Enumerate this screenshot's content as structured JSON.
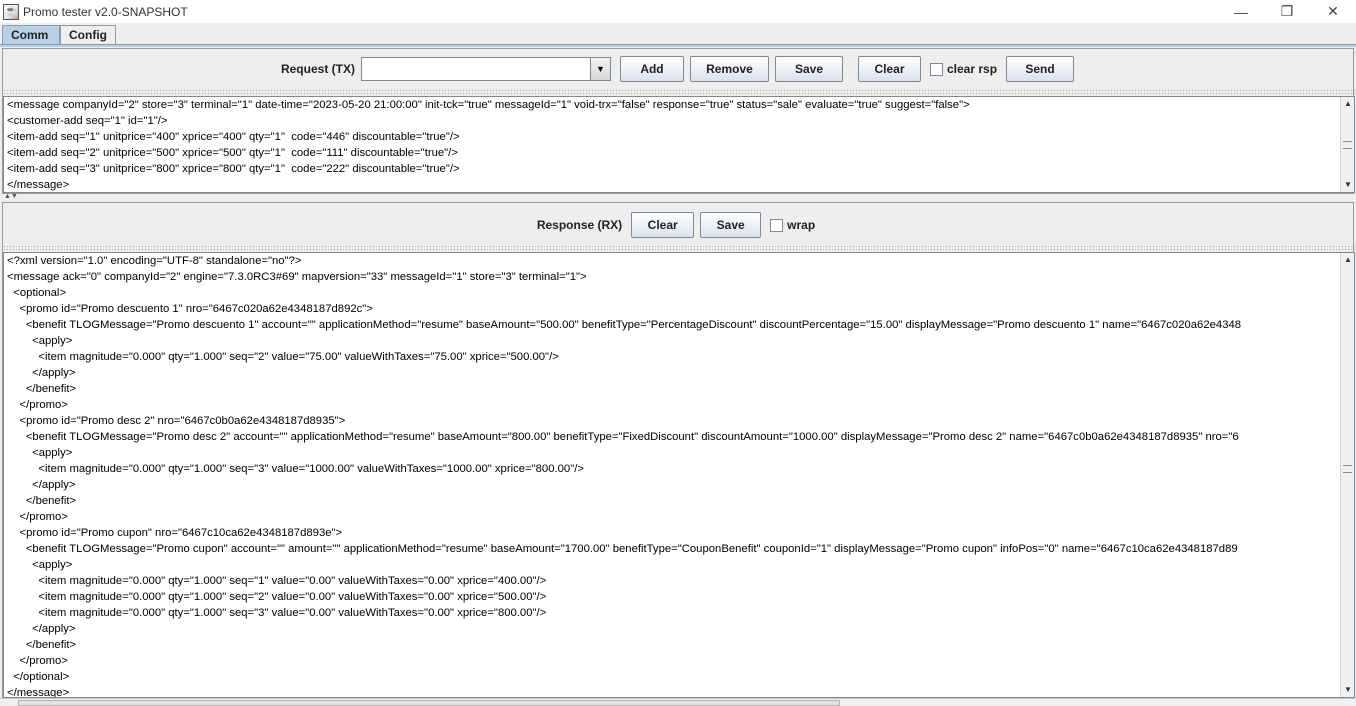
{
  "window": {
    "title": "Promo tester v2.0-SNAPSHOT",
    "icon": "java-cup-icon",
    "minimize_label": "—",
    "maximize_label": "❐",
    "close_label": "✕"
  },
  "tabs": [
    {
      "label": "Comm",
      "active": true
    },
    {
      "label": "Config",
      "active": false
    }
  ],
  "request": {
    "label": "Request (TX)",
    "combo_value": "",
    "buttons": {
      "add": "Add",
      "remove": "Remove",
      "save": "Save",
      "clear": "Clear",
      "send": "Send"
    },
    "clear_rsp_label": "clear rsp",
    "clear_rsp_checked": false,
    "lines": [
      "<message companyId=\"2\" store=\"3\" terminal=\"1\" date-time=\"2023-05-20 21:00:00\" init-tck=\"true\" messageId=\"1\" void-trx=\"false\" response=\"true\" status=\"sale\" evaluate=\"true\" suggest=\"false\">",
      "<customer-add seq=\"1\" id=\"1\"/>",
      "<item-add seq=\"1\" unitprice=\"400\" xprice=\"400\" qty=\"1\"  code=\"446\" discountable=\"true\"/>",
      "<item-add seq=\"2\" unitprice=\"500\" xprice=\"500\" qty=\"1\"  code=\"111\" discountable=\"true\"/>",
      "<item-add seq=\"3\" unitprice=\"800\" xprice=\"800\" qty=\"1\"  code=\"222\" discountable=\"true\"/>",
      "</message>"
    ]
  },
  "response": {
    "label": "Response (RX)",
    "buttons": {
      "clear": "Clear",
      "save": "Save"
    },
    "wrap_label": "wrap",
    "wrap_checked": false,
    "lines": [
      "<?xml version=\"1.0\" encoding=\"UTF-8\" standalone=\"no\"?>",
      "<message ack=\"0\" companyId=\"2\" engine=\"7.3.0RC3#69\" mapversion=\"33\" messageId=\"1\" store=\"3\" terminal=\"1\">",
      "  <optional>",
      "    <promo id=\"Promo descuento 1\" nro=\"6467c020a62e4348187d892c\">",
      "      <benefit TLOGMessage=\"Promo descuento 1\" account=\"\" applicationMethod=\"resume\" baseAmount=\"500.00\" benefitType=\"PercentageDiscount\" discountPercentage=\"15.00\" displayMessage=\"Promo descuento 1\" name=\"6467c020a62e4348",
      "        <apply>",
      "          <item magnitude=\"0.000\" qty=\"1.000\" seq=\"2\" value=\"75.00\" valueWithTaxes=\"75.00\" xprice=\"500.00\"/>",
      "        </apply>",
      "      </benefit>",
      "    </promo>",
      "    <promo id=\"Promo desc 2\" nro=\"6467c0b0a62e4348187d8935\">",
      "      <benefit TLOGMessage=\"Promo desc 2\" account=\"\" applicationMethod=\"resume\" baseAmount=\"800.00\" benefitType=\"FixedDiscount\" discountAmount=\"1000.00\" displayMessage=\"Promo desc 2\" name=\"6467c0b0a62e4348187d8935\" nro=\"6",
      "        <apply>",
      "          <item magnitude=\"0.000\" qty=\"1.000\" seq=\"3\" value=\"1000.00\" valueWithTaxes=\"1000.00\" xprice=\"800.00\"/>",
      "        </apply>",
      "      </benefit>",
      "    </promo>",
      "    <promo id=\"Promo cupon\" nro=\"6467c10ca62e4348187d893e\">",
      "      <benefit TLOGMessage=\"Promo cupon\" account=\"\" amount=\"\" applicationMethod=\"resume\" baseAmount=\"1700.00\" benefitType=\"CouponBenefit\" couponId=\"1\" displayMessage=\"Promo cupon\" infoPos=\"0\" name=\"6467c10ca62e4348187d89",
      "        <apply>",
      "          <item magnitude=\"0.000\" qty=\"1.000\" seq=\"1\" value=\"0.00\" valueWithTaxes=\"0.00\" xprice=\"400.00\"/>",
      "          <item magnitude=\"0.000\" qty=\"1.000\" seq=\"2\" value=\"0.00\" valueWithTaxes=\"0.00\" xprice=\"500.00\"/>",
      "          <item magnitude=\"0.000\" qty=\"1.000\" seq=\"3\" value=\"0.00\" valueWithTaxes=\"0.00\" xprice=\"800.00\"/>",
      "        </apply>",
      "      </benefit>",
      "    </promo>",
      "  </optional>",
      "</message>"
    ]
  },
  "colors": {
    "tab_active": "#b8cfe5",
    "panel_bg": "#eeeeee",
    "border": "#7a8a99"
  }
}
